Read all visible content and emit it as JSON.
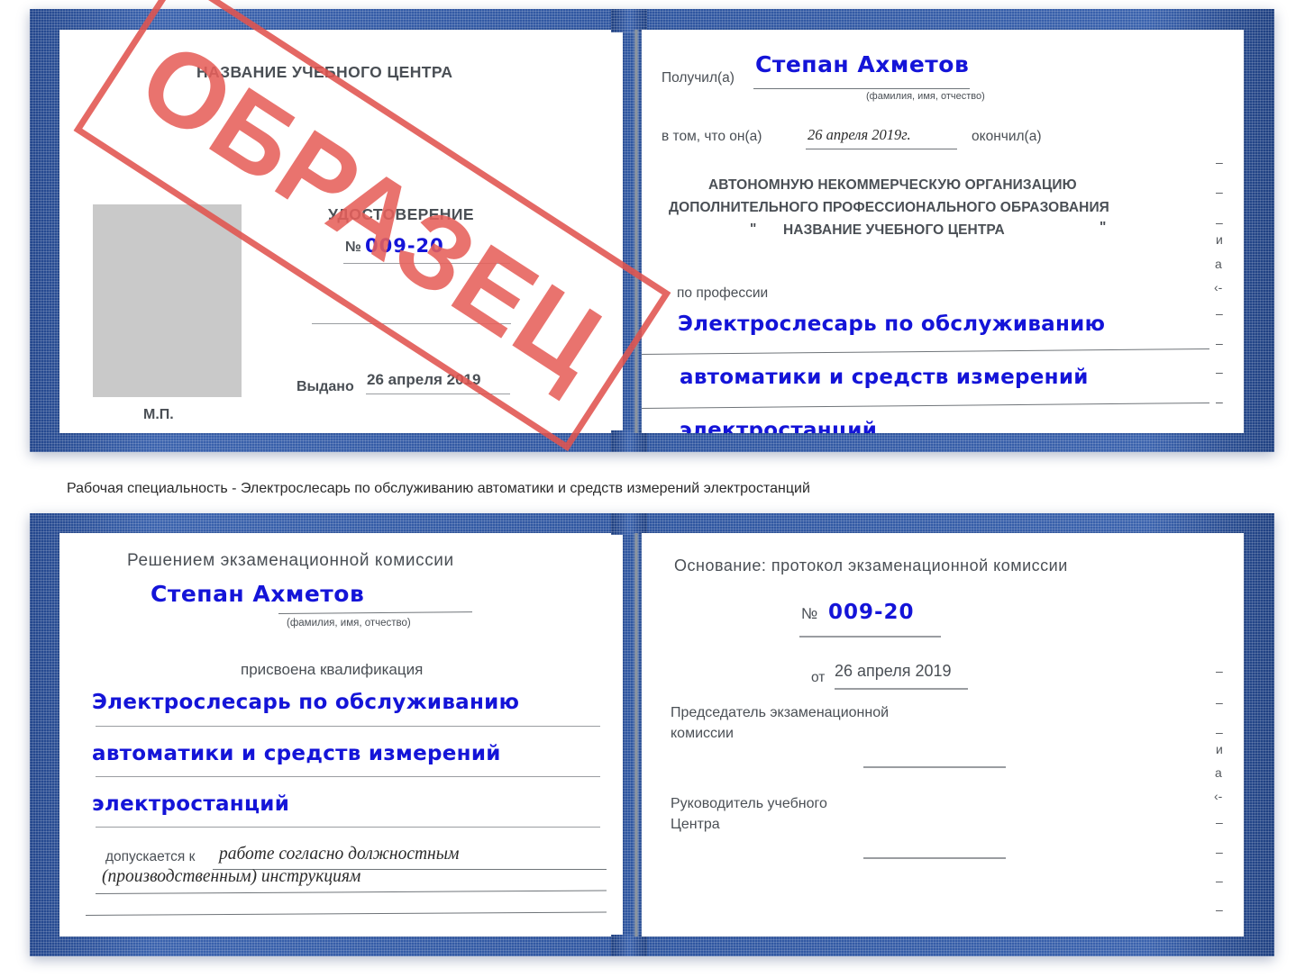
{
  "document": {
    "type": "Удостоверение (свидетельство) о присвоении рабочей профессии",
    "stamp_label": "ОБРАЗЕЦ",
    "accent_blue": "#2f56a0",
    "ink_blue": "#1414d8",
    "stamp_red": "#e1544f",
    "photo_placeholder_color": "#c9c9c9"
  },
  "caption": {
    "text": "Рабочая специальность - Электрослесарь по обслуживанию автоматики и средств измерений электростанций"
  },
  "certificate_top": {
    "left_page": {
      "org_title": "НАЗВАНИЕ УЧЕБНОГО ЦЕНТРА",
      "doc_title": "УДОСТОВЕРЕНИЕ",
      "number_label": "№",
      "number_value": "009-20",
      "issued_label": "Выдано",
      "issued_value": "26 апреля 2019",
      "seal_label": "М.П.",
      "photo_caption": ""
    },
    "right_page": {
      "received_label": "Получил(а)",
      "received_value": "Степан Ахметов",
      "fio_hint": "(фамилия, имя, отчество)",
      "in_that_label": "в том, что он(а)",
      "completion_date": "26 апреля 2019г.",
      "finished_label": "окончил(а)",
      "org_line1": "АВТОНОМНУЮ НЕКОММЕРЧЕСКУЮ ОРГАНИЗАЦИЮ",
      "org_line2": "ДОПОЛНИТЕЛЬНОГО ПРОФЕССИОНАЛЬНОГО ОБРАЗОВАНИЯ",
      "org_quote_open": "\"",
      "org_line3": "НАЗВАНИЕ УЧЕБНОГО ЦЕНТРА",
      "org_quote_close": "\"",
      "profession_label": "по профессии",
      "profession_line1": "Электрослесарь по обслуживанию",
      "profession_line2": "автоматики и средств измерений",
      "profession_line3": "электростанций",
      "edge_marks": [
        "–",
        "–",
        "–",
        "и",
        "а",
        "‹-",
        "–",
        "–",
        "–",
        "–"
      ]
    }
  },
  "certificate_bottom": {
    "left_page": {
      "heading": "Решением экзаменационной комиссии",
      "name_value": "Степан Ахметов",
      "fio_hint": "(фамилия, имя, отчество)",
      "qualification_label": "присвоена квалификация",
      "qualification_line1": "Электрослесарь по обслуживанию",
      "qualification_line2": "автоматики и средств измерений",
      "qualification_line3": "электростанций",
      "admitted_label": "допускается к",
      "admitted_line1": "работе согласно должностным",
      "admitted_line2": "(производственным) инструкциям"
    },
    "right_page": {
      "basis_label": "Основание: протокол экзаменационной комиссии",
      "number_label": "№",
      "number_value": "009-20",
      "date_label": "от",
      "date_value": "26 апреля 2019",
      "chairman_line1": "Председатель экзаменационной",
      "chairman_line2": "комиссии",
      "head_line1": "Руководитель учебного",
      "head_line2": "Центра",
      "edge_marks": [
        "–",
        "–",
        "–",
        "и",
        "а",
        "‹-",
        "–",
        "–",
        "–",
        "–"
      ]
    }
  }
}
